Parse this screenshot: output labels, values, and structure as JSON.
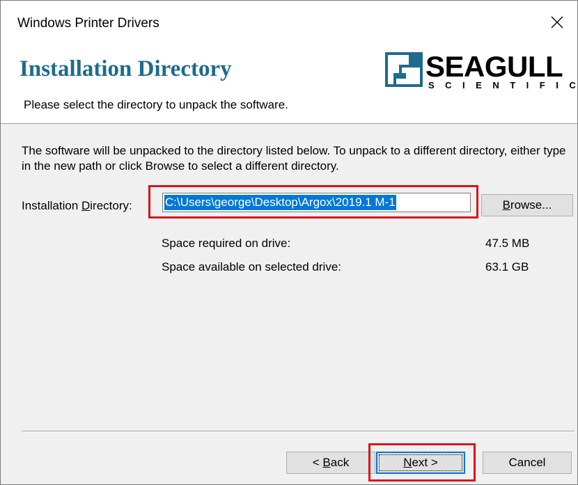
{
  "window": {
    "title": "Windows Printer Drivers",
    "close_icon": "close-icon"
  },
  "header": {
    "heading": "Installation Directory",
    "subheading": "Please select the directory to unpack the software.",
    "logo": {
      "word": "SEAGULL",
      "sub": "SCIENTIFIC"
    }
  },
  "main": {
    "description": "The software will be unpacked to the directory listed below.  To unpack to a different directory, either type in the new path or click Browse to select a different directory.",
    "dir_label_pre": "Installation ",
    "dir_label_accel": "D",
    "dir_label_post": "irectory:",
    "dir_value": "C:\\Users\\george\\Desktop\\Argox\\2019.1 M-1",
    "browse_accel": "B",
    "browse_post": "rowse...",
    "space_required_label": "Space required on drive:",
    "space_required_value": "47.5 MB",
    "space_available_label": "Space available on selected drive:",
    "space_available_value": "63.1 GB"
  },
  "footer": {
    "back_pre": "< ",
    "back_accel": "B",
    "back_post": "ack",
    "next_accel": "N",
    "next_post": "ext >",
    "cancel_label": "Cancel"
  },
  "colors": {
    "heading": "#1e6b8c",
    "highlight": "#d8141c",
    "selection": "#0078d7"
  }
}
